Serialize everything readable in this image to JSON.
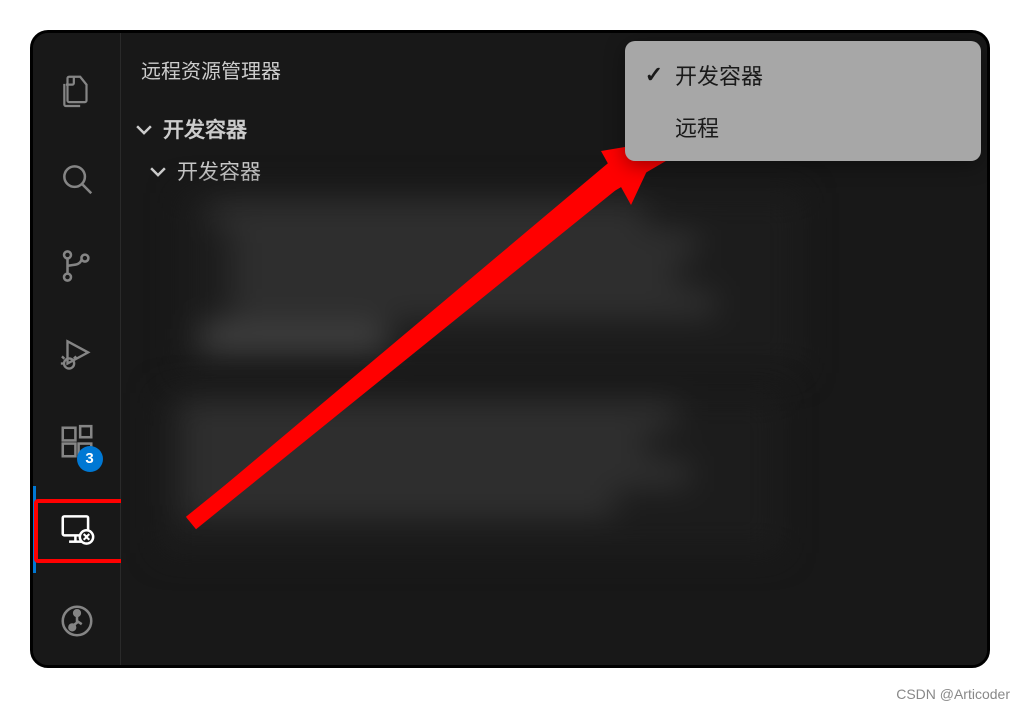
{
  "sidebar": {
    "title": "远程资源管理器",
    "tree": {
      "root_label": "开发容器",
      "child_label": "开发容器"
    }
  },
  "dropdown": {
    "items": [
      {
        "label": "开发容器",
        "checked": true
      },
      {
        "label": "远程",
        "checked": false
      }
    ]
  },
  "activity": {
    "badge_count": "3"
  },
  "watermark": "CSDN @Articoder"
}
